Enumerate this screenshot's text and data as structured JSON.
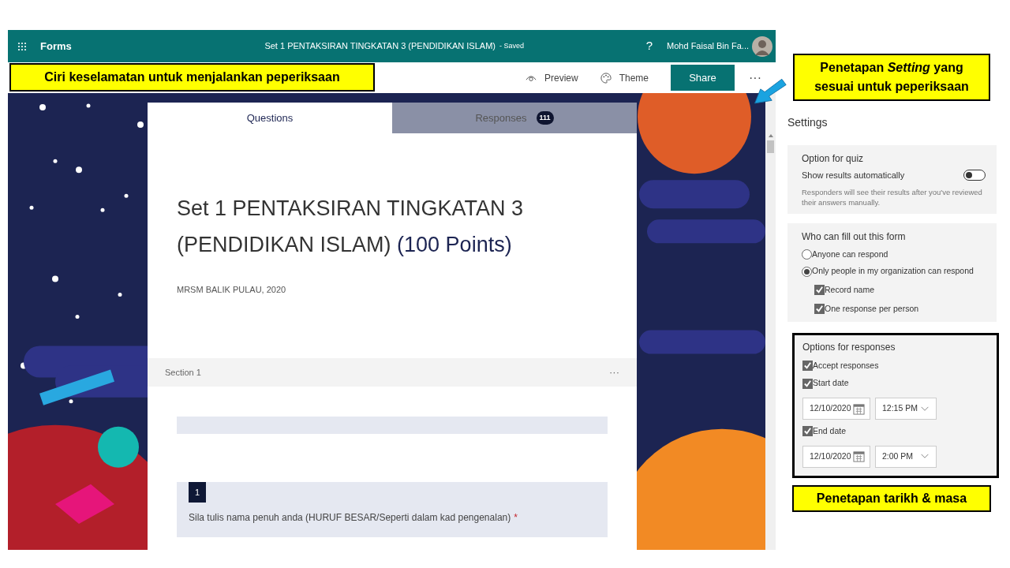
{
  "annotations": [
    {
      "text": "Ciri keselamatan untuk menjalankan peperiksaan"
    },
    {
      "text": "Penetapan *Setting* yang sesuai untuk peperiksaan"
    },
    {
      "text": "Penetapan tarikh & masa"
    }
  ],
  "app_bar": {
    "app_name": "Forms",
    "form_title": "Set 1 PENTAKSIRAN TINGKATAN 3 (PENDIDIKAN ISLAM)",
    "save_status": "- Saved",
    "help": "?",
    "user": "Mohd Faisal Bin Fa..."
  },
  "toolbar": [
    {
      "kind": "preview",
      "label": "Preview"
    },
    {
      "kind": "theme",
      "label": "Theme"
    },
    {
      "kind": "share",
      "label": "Share"
    },
    {
      "kind": "more",
      "label": "···"
    }
  ],
  "tabs": [
    {
      "label": "Questions",
      "selected": true
    },
    {
      "label": "Responses",
      "selected": false,
      "badge": "111"
    }
  ],
  "form": {
    "title": "Set 1 PENTAKSIRAN TINGKATAN 3 (PENDIDIKAN ISLAM)",
    "points": "(100 Points)",
    "subtitle": "MRSM BALIK PULAU, 2020",
    "section": {
      "label": "Section 1",
      "more": "···"
    },
    "questions": [
      {
        "number": "1",
        "text": "Sila tulis nama penuh anda (HURUF BESAR/Seperti dalam kad pengenalan)",
        "required": true,
        "required_mark": "*"
      }
    ]
  },
  "settings": {
    "title": "Settings",
    "groups": [
      {
        "title": "Option for quiz",
        "highlighted": false,
        "items": [
          {
            "kind": "toggle",
            "label": "Show results automatically",
            "on": false
          },
          {
            "kind": "note",
            "label": "Responders will see their results after you've reviewed their answers manually."
          }
        ]
      },
      {
        "title": "Who can fill out this form",
        "highlighted": false,
        "items": [
          {
            "kind": "radio",
            "label": "Anyone can respond",
            "selected": false
          },
          {
            "kind": "radio",
            "label": "Only people in my organization can respond",
            "selected": true,
            "children": [
              {
                "kind": "checkbox",
                "label": "Record name",
                "checked": true
              },
              {
                "kind": "checkbox",
                "label": "One response per person",
                "checked": true
              }
            ]
          }
        ]
      },
      {
        "title": "Options for responses",
        "highlighted": true,
        "items": [
          {
            "kind": "checkbox",
            "label": "Accept responses",
            "checked": true
          },
          {
            "kind": "checkbox",
            "label": "Start date",
            "checked": true,
            "date": "12/10/2020",
            "time": "12:15 PM"
          },
          {
            "kind": "checkbox",
            "label": "End date",
            "checked": true,
            "date": "12/10/2020",
            "time": "2:00 PM"
          }
        ]
      }
    ]
  }
}
